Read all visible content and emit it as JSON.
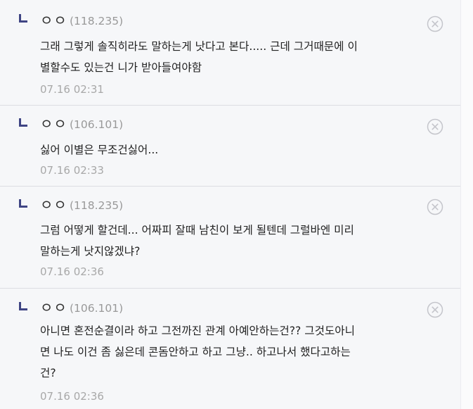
{
  "comments": [
    {
      "nickname": "ㅇㅇ",
      "ip": "(118.235)",
      "text": "그래 그렇게 솔직히라도 말하는게 낫다고 본다..... 근데 그거때문에 이\n별할수도 있는건 니가 받아들여야함",
      "date": "07.16 02:31",
      "delete_icon": "close-circle-icon"
    },
    {
      "nickname": "ㅇㅇ",
      "ip": "(106.101)",
      "text": "싫어 이별은 무조건싫어...",
      "date": "07.16 02:33",
      "delete_icon": "close-circle-icon"
    },
    {
      "nickname": "ㅇㅇ",
      "ip": "(118.235)",
      "text": "그럼 어떻게 할건데... 어짜피 잘때 남친이 보게 될텐데 그럴바엔 미리\n말하는게 낫지않겠냐?",
      "date": "07.16 02:36",
      "delete_icon": "close-circle-icon"
    },
    {
      "nickname": "ㅇㅇ",
      "ip": "(106.101)",
      "text": "아니면 혼전순결이라 하고 그전까진 관계 아예안하는건?? 그것도아니\n면 나도 이건 좀 싫은데 콘돔안하고 하고 그냥.. 하고나서 했다고하는\n건?",
      "date": "07.16 02:36",
      "delete_icon": "close-circle-icon"
    }
  ],
  "colors": {
    "background": "#f6f7f9",
    "reply_arrow": "#3f4584",
    "text": "#222222",
    "meta": "#999999"
  }
}
